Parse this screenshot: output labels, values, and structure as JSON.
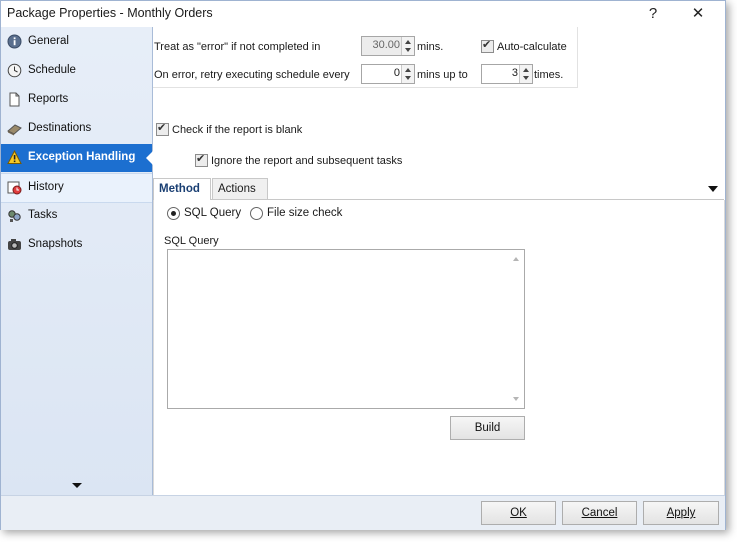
{
  "window": {
    "title": "Package Properties - Monthly Orders",
    "help_label": "?",
    "close_label": "✕"
  },
  "sidebar": {
    "items": [
      {
        "label": "General",
        "icon": "info-icon"
      },
      {
        "label": "Schedule",
        "icon": "clock-icon"
      },
      {
        "label": "Reports",
        "icon": "document-icon"
      },
      {
        "label": "Destinations",
        "icon": "destination-icon"
      },
      {
        "label": "Exception Handling",
        "icon": "warning-icon",
        "active": true
      },
      {
        "label": "History",
        "icon": "history-icon"
      },
      {
        "label": "Tasks",
        "icon": "tasks-icon"
      },
      {
        "label": "Snapshots",
        "icon": "camera-icon"
      }
    ]
  },
  "exception": {
    "treat_error_label": "Treat as \"error\" if not completed in",
    "treat_error_value": "30.00",
    "mins_label": "mins.",
    "auto_calc_label": "Auto-calculate",
    "auto_calc_checked": true,
    "retry_label": "On error, retry  executing schedule every",
    "retry_value": "0",
    "mins_up_to_label": "mins up to",
    "times_value": "3",
    "times_label": "times.",
    "check_blank_label": "Check if the report is blank",
    "check_blank_checked": true,
    "ignore_label": "Ignore the report and subsequent tasks",
    "ignore_checked": true
  },
  "tabs": {
    "method_label": "Method",
    "actions_label": "Actions"
  },
  "method": {
    "sql_query_radio": "SQL Query",
    "file_size_radio": "File size check",
    "selected": "SQL Query",
    "sql_query_label": "SQL Query",
    "sql_query_value": "",
    "build_label": "Build"
  },
  "footer": {
    "ok_label": "OK",
    "cancel_label": "Cancel",
    "apply_label": "Apply"
  },
  "colors": {
    "active_nav": "#1c6fd0",
    "sidebar_bg": "#dbe5f3",
    "tab_text": "#1a3f73"
  }
}
